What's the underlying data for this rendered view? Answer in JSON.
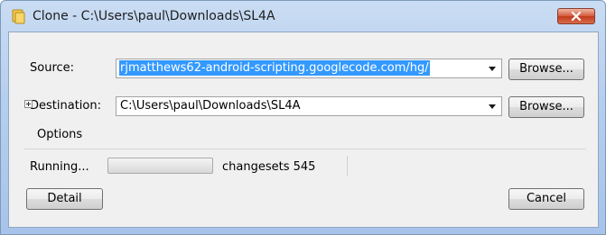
{
  "window": {
    "title": "Clone - C:\\Users\\paul\\Downloads\\SL4A",
    "icon": "hg-folder-icon"
  },
  "form": {
    "source_label": "Source:",
    "source_value": "rjmatthews62-android-scripting.googlecode.com/hg/",
    "destination_label": "Destination:",
    "destination_value": "C:\\Users\\paul\\Downloads\\SL4A",
    "browse_label": "Browse...",
    "options_label": "Options"
  },
  "status": {
    "running_label": "Running...",
    "progress_fraction": 0,
    "changesets_text": "changesets 545"
  },
  "buttons": {
    "detail_label": "Detail",
    "cancel_label": "Cancel"
  },
  "colors": {
    "selection": "#3399ff",
    "close_button": "#c23a1c",
    "titlebar": "#b7cfee"
  }
}
